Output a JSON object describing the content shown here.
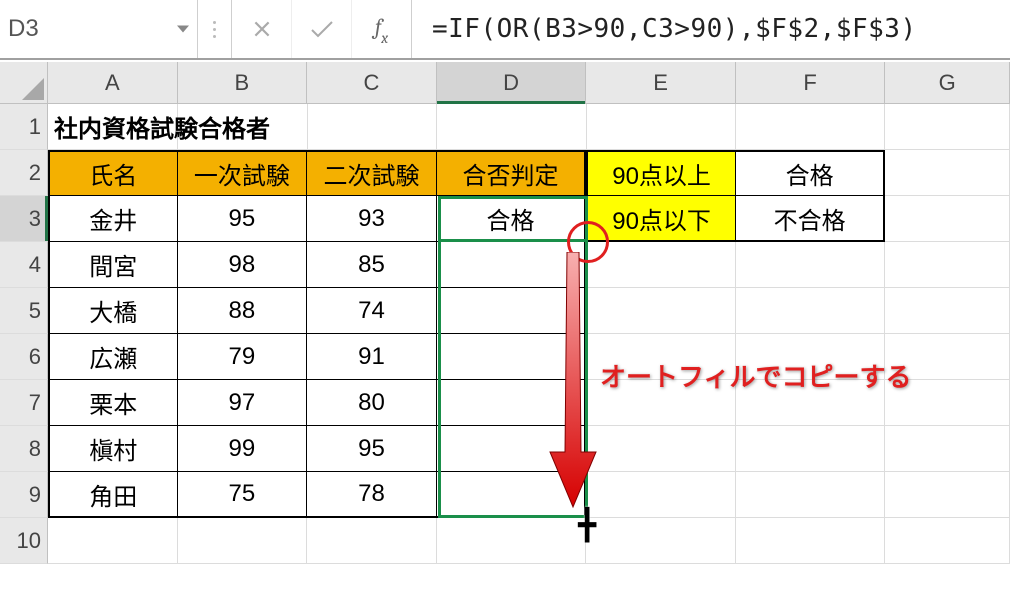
{
  "formula_bar": {
    "name_box": "D3",
    "formula": "=IF(OR(B3>90,C3>90),$F$2,$F$3)"
  },
  "column_headers": [
    "A",
    "B",
    "C",
    "D",
    "E",
    "F",
    "G"
  ],
  "row_headers": [
    "1",
    "2",
    "3",
    "4",
    "5",
    "6",
    "7",
    "8",
    "9",
    "10"
  ],
  "title_cell": "社内資格試験合格者",
  "data_headers": {
    "A": "氏名",
    "B": "一次試験",
    "C": "二次試験",
    "D": "合否判定"
  },
  "side": {
    "E2": "90点以上",
    "F2": "合格",
    "E3": "90点以下",
    "F3": "不合格"
  },
  "rows": [
    {
      "name": "金井",
      "s1": "95",
      "s2": "93",
      "res": "合格"
    },
    {
      "name": "間宮",
      "s1": "98",
      "s2": "85",
      "res": ""
    },
    {
      "name": "大橋",
      "s1": "88",
      "s2": "74",
      "res": ""
    },
    {
      "name": "広瀬",
      "s1": "79",
      "s2": "91",
      "res": ""
    },
    {
      "name": "栗本",
      "s1": "97",
      "s2": "80",
      "res": ""
    },
    {
      "name": "槇村",
      "s1": "99",
      "s2": "95",
      "res": ""
    },
    {
      "name": "角田",
      "s1": "75",
      "s2": "78",
      "res": ""
    }
  ],
  "annotation": "オートフィルでコピーする",
  "chart_data": {
    "type": "table",
    "title": "社内資格試験合格者",
    "columns": [
      "氏名",
      "一次試験",
      "二次試験",
      "合否判定"
    ],
    "rows": [
      [
        "金井",
        95,
        93,
        "合格"
      ],
      [
        "間宮",
        98,
        85,
        null
      ],
      [
        "大橋",
        88,
        74,
        null
      ],
      [
        "広瀬",
        79,
        91,
        null
      ],
      [
        "栗本",
        97,
        80,
        null
      ],
      [
        "槇村",
        99,
        95,
        null
      ],
      [
        "角田",
        75,
        78,
        null
      ]
    ],
    "lookup": {
      "90点以上": "合格",
      "90点以下": "不合格"
    },
    "formula_D3": "=IF(OR(B3>90,C3>90),$F$2,$F$3)"
  },
  "colors": {
    "orange": "#f4b000",
    "yellow": "#ffff00",
    "selection_border": "#1a8f4a",
    "annotation_red": "#e02020"
  }
}
